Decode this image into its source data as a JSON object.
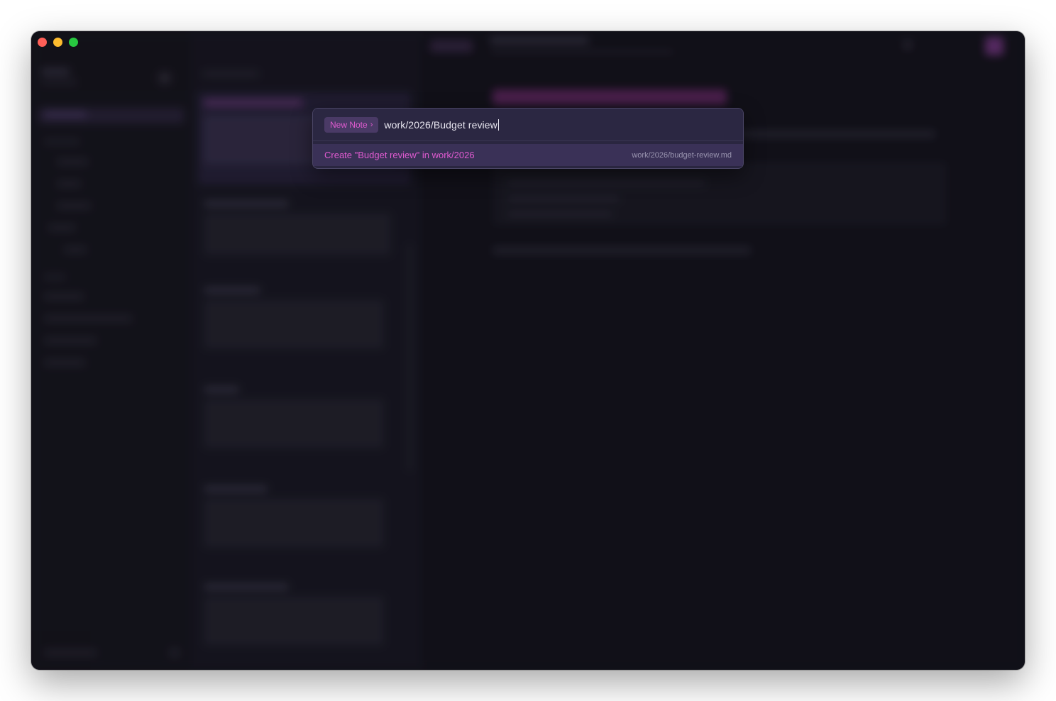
{
  "palette": {
    "mode_label": "New Note",
    "mode_chevron": "›",
    "input_value": "work/2026/Budget review",
    "result": {
      "label": "Create \"Budget review\" in work/2026",
      "path": "work/2026/budget-review.md"
    }
  },
  "colors": {
    "accent": "#e05bd0",
    "window_bg": "#14131d",
    "palette_bg": "#2a2640",
    "selected_row": "#3a3157"
  },
  "icons": {
    "close": "close-window-icon",
    "minimize": "minimize-window-icon",
    "maximize": "maximize-window-icon"
  }
}
